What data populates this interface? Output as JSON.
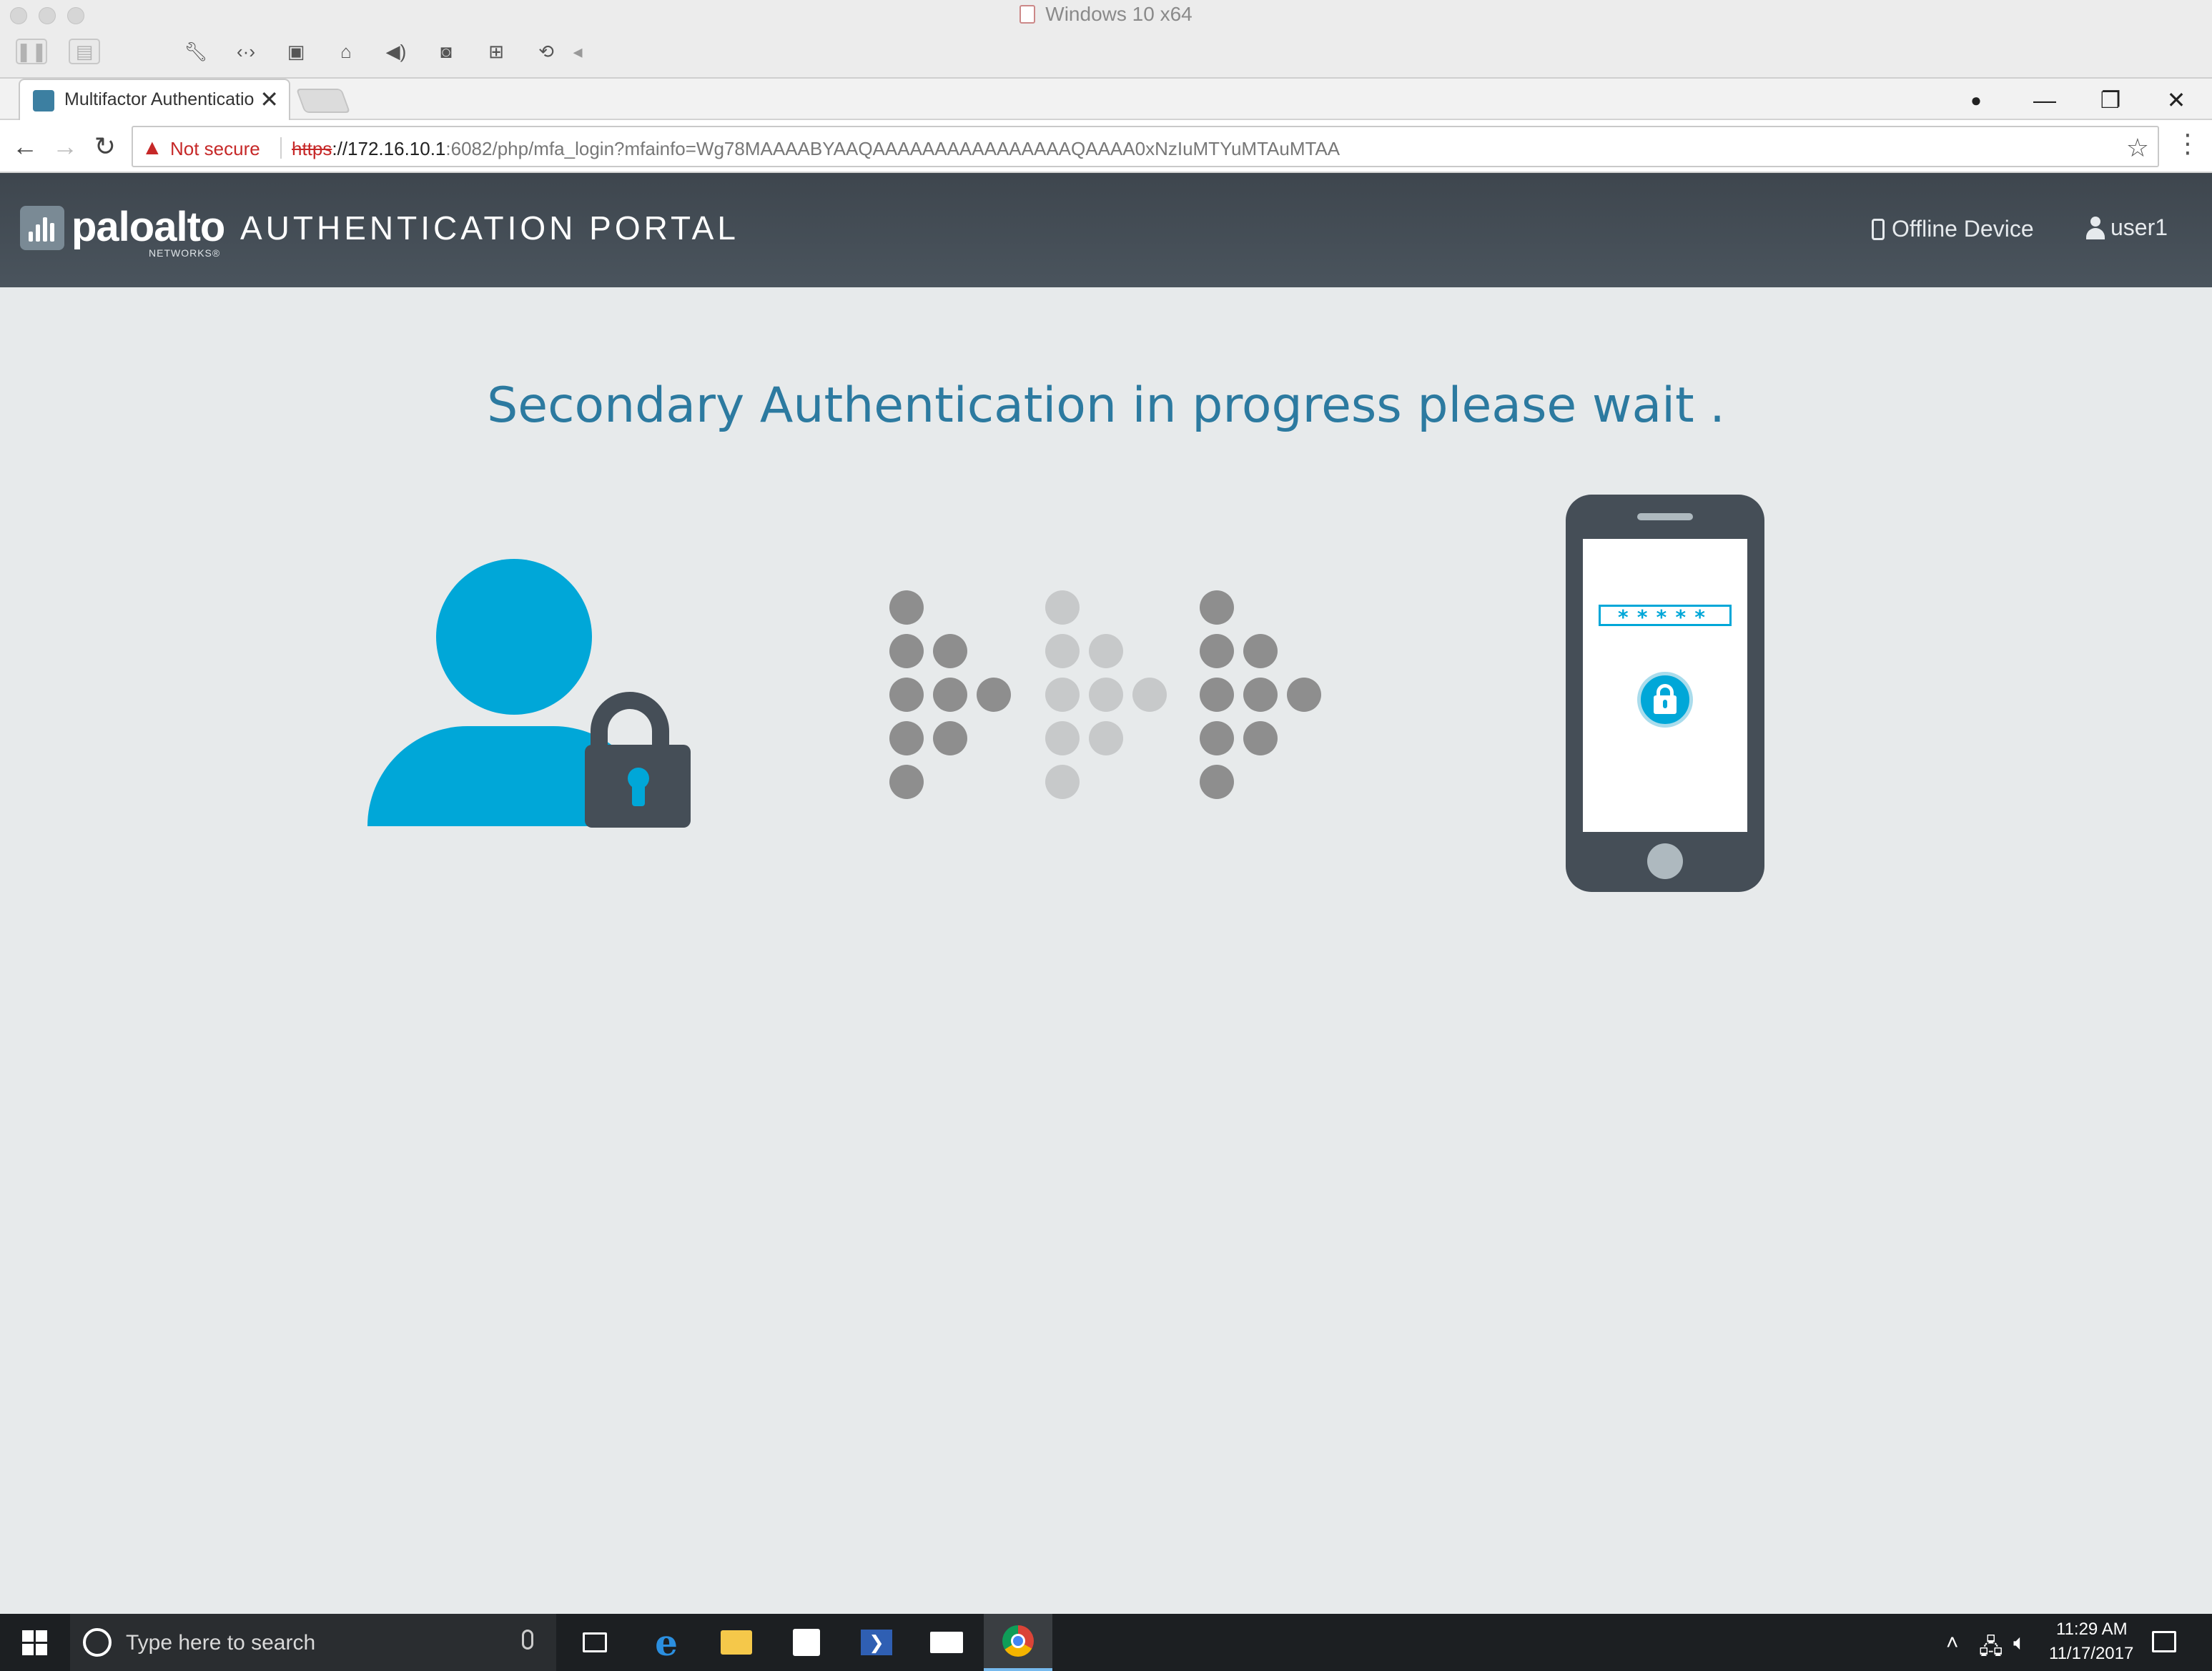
{
  "vm": {
    "title": "Windows 10 x64",
    "toolbar_icons": [
      "pause-icon",
      "snapshot-icon",
      "settings-wrench-icon",
      "network-icon",
      "hdd-icon",
      "printer-icon",
      "sound-icon",
      "camera-icon",
      "usb-icon",
      "shared-folder-icon",
      "collapse-arrow-icon"
    ]
  },
  "browser": {
    "tab_title": "Multifactor Authenticatio",
    "tab_close": "✕",
    "nav": {
      "back": "←",
      "forward": "→",
      "reload": "↻"
    },
    "security_label": "Not secure",
    "url_scheme": "https",
    "url_host": "://172.16.10.1",
    "url_rest": ":6082/php/mfa_login?mfainfo=Wg78MAAAABYAAQAAAAAAAAAAAAAAAAQAAAA0xNzIuMTYuMTAuMTAA",
    "star": "☆",
    "menu": "⋮",
    "window_controls": {
      "profile": "●",
      "minimize": "—",
      "restore": "❐",
      "close": "✕"
    }
  },
  "portal": {
    "logo_text": "paloalto",
    "logo_sub": "NETWORKS®",
    "title": "AUTHENTICATION PORTAL",
    "offline_device": "Offline Device",
    "user": "user1",
    "status_message": "Secondary Authentication in progress please wait .",
    "phone_password_mask": "*****"
  },
  "colors": {
    "accent": "#00a7d8",
    "dark": "#454e57",
    "message": "#2c7aa0",
    "dot_dark": "#8e8e8e",
    "dot_light": "#c7c9ca"
  },
  "taskbar": {
    "search_placeholder": "Type here to search",
    "apps": [
      "task-view-icon",
      "edge-icon",
      "file-explorer-icon",
      "store-icon",
      "powershell-icon",
      "mail-icon",
      "chrome-icon"
    ],
    "time": "11:29 AM",
    "date": "11/17/2017"
  }
}
